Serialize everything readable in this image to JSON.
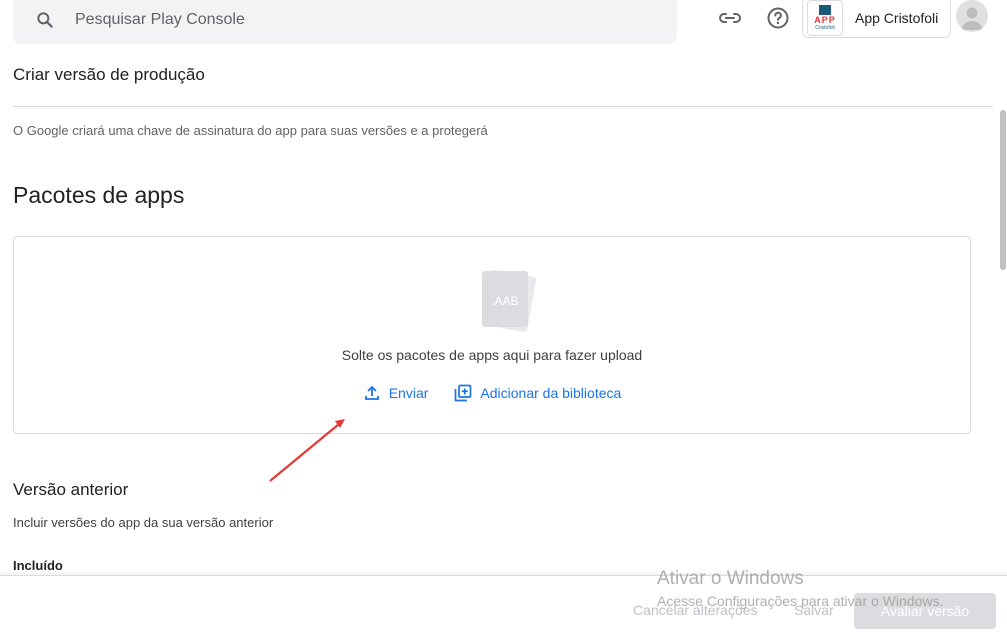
{
  "header": {
    "search_placeholder": "Pesquisar Play Console",
    "app_name": "App Cristofoli",
    "app_logo_text": "APP",
    "app_logo_sub": "Cristofoli"
  },
  "page": {
    "title": "Criar versão de produção",
    "signing_info": "O Google criará uma chave de assinatura do app para suas versões e a protegerá"
  },
  "app_bundles": {
    "title": "Pacotes de apps",
    "icon_label": ".AAB",
    "drop_text": "Solte os pacotes de apps aqui para fazer upload",
    "upload_label": "Enviar",
    "library_label": "Adicionar da biblioteca"
  },
  "previous_version": {
    "title": "Versão anterior",
    "description": "Incluir versões do app da sua versão anterior",
    "included_label": "Incluído"
  },
  "footer": {
    "cancel_label": "Cancelar alterações",
    "save_label": "Salvar",
    "review_label": "Avaliar versão"
  },
  "watermark": {
    "title": "Ativar o Windows",
    "subtitle": "Acesse Configurações para ativar o Windows."
  },
  "colors": {
    "accent": "#1a73e8",
    "annotation_arrow": "#e53935"
  }
}
